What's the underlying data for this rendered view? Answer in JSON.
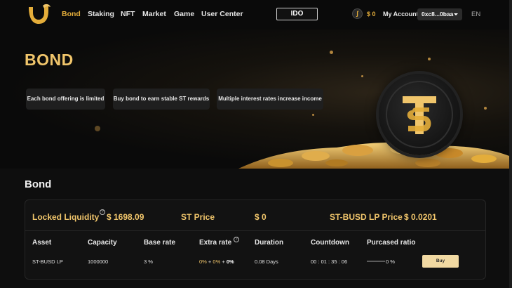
{
  "nav": {
    "links": [
      {
        "label": "Bond",
        "active": true
      },
      {
        "label": "Staking",
        "active": false
      },
      {
        "label": "NFT",
        "active": false
      },
      {
        "label": "Market",
        "active": false
      },
      {
        "label": "Game",
        "active": false
      },
      {
        "label": "User Center",
        "active": false
      }
    ],
    "ido_label": "IDO",
    "balance": "$ 0",
    "my_account": "My Account",
    "wallet": "0xc8...0baa",
    "language": "EN"
  },
  "hero": {
    "title": "BOND",
    "chips": [
      "Each bond offering is limited",
      "Buy bond to earn stable ST rewards",
      "Multiple interest rates increase income"
    ]
  },
  "bond": {
    "section_title": "Bond",
    "locked_liquidity_label": "Locked Liquidity",
    "locked_liquidity_value": "$ 1698.09",
    "st_price_label": "ST Price",
    "st_price_value": "$ 0",
    "lp_price_label": "ST-BUSD LP Price",
    "lp_price_value": "$ 0.0201",
    "columns": [
      "Asset",
      "Capacity",
      "Base rate",
      "Extra rate",
      "Duration",
      "Countdown",
      "Purcased ratio"
    ],
    "row": {
      "asset": "ST-BUSD LP",
      "capacity": "1000000",
      "base_rate": "3 %",
      "extra_rate_a": "0%",
      "extra_rate_plus1": " + ",
      "extra_rate_b": "0%",
      "extra_rate_plus2": " + ",
      "extra_rate_c": "0%",
      "duration": "0.08 Days",
      "countdown": "00 : 01 : 35 : 06",
      "ratio_text": "0 %",
      "ratio_value": 0,
      "buy_label": "Buy"
    }
  },
  "colors": {
    "accent": "#e4ad3a",
    "gold_text": "#f0c56b",
    "buy_button": "#f1d9a2"
  }
}
